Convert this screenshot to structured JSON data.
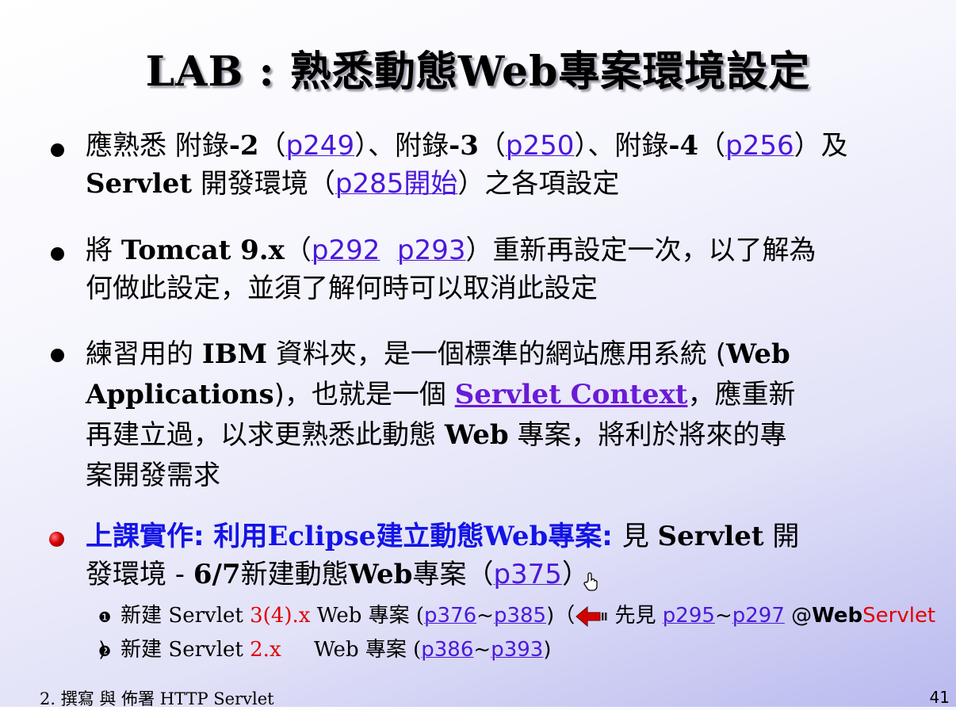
{
  "title": "LAB : 熟悉動態Web專案環境設定",
  "bullet1": {
    "t1": "應熟悉 附錄",
    "t1b": "-2",
    "t2": "（",
    "link1": "p249",
    "t3": "）、附錄",
    "t3b": "-3",
    "t4": "（",
    "link2": "p250",
    "t5": "）、附錄",
    "t5b": "-4",
    "t6": "（",
    "link3": "p256",
    "t7": "）及",
    "t8b": "Servlet",
    "t9": " 開發環境（",
    "link4": "p285開始",
    "t10": "）之各項設定"
  },
  "bullet2": {
    "t1": "將 ",
    "t1b": "Tomcat 9.x",
    "t2": "（",
    "link1": "p292",
    "link2": "p293",
    "t3": "）重新再設定一次，以了解為",
    "t4": "何做此設定，並須了解何時可以取消此設定"
  },
  "bullet3": {
    "t1": "練習用的 ",
    "t1b": "IBM",
    "t2": " 資料夾，是一個標準的網站應用系統 (",
    "t2b": "Web",
    "t3b": "Applications",
    "t3": ")，也就是一個 ",
    "link1": "Servlet Context",
    "t4": "，應重新",
    "t5": "再建立過，以求更熟悉此動態 ",
    "t5b": "Web",
    "t6": " 專案，將利於將來的專",
    "t7": "案開發需求"
  },
  "bullet4": {
    "t1": "上課實作: 利用",
    "t1b": "Eclipse",
    "t2": "建立動態",
    "t2b": "Web",
    "t3": "專案: ",
    "t4": "見 ",
    "t4b": "Servlet",
    "t5": " 開",
    "t6": "發環境 - ",
    "t6b": "6/7",
    "t7": "新建動態",
    "t7b": "Web",
    "t8": "專案（",
    "link1": "p375",
    "t9": "）"
  },
  "sub1": {
    "num": "❶",
    "t1": "新建 Servlet ",
    "ver": "3(4).x",
    "t2": " Web 專案 (",
    "link1": "p376",
    "tilde": "~",
    "link2": "p385",
    "t3": ")（",
    "t4": " 先見 ",
    "link3": "p295",
    "link4": "p297",
    "t5": " @",
    "web": "Web",
    "servlet": "Servlet",
    "t6": " )"
  },
  "sub2": {
    "num": "❷",
    "t1": "新建 Servlet ",
    "ver": "2.x",
    "t2": "     Web 專案 (",
    "link1": "p386",
    "tilde": "~",
    "link2": "p393",
    "t3": ")"
  },
  "footer": {
    "left": "2. 撰寫 與 佈署 HTTP Servlet",
    "page": "41"
  },
  "icons": {
    "bullet": "bullet-dot-icon",
    "back": "back-arrow-icon",
    "cursor": "hand-cursor-icon"
  }
}
